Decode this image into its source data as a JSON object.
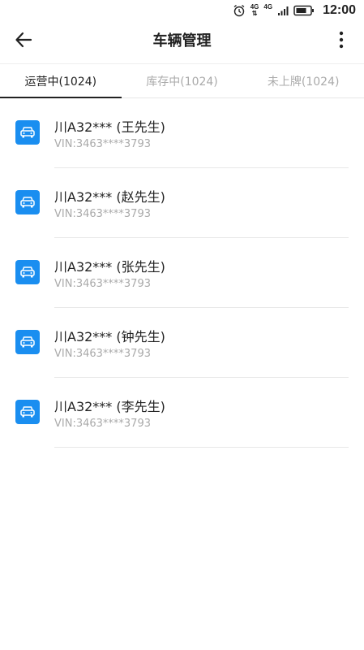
{
  "status_bar": {
    "time": "12:00",
    "net1": "4G",
    "net2": "4G",
    "icons": [
      "alarm-icon",
      "signal-4g-icon",
      "signal-4g-icon",
      "signal-bars-icon",
      "battery-icon"
    ]
  },
  "toolbar": {
    "title": "车辆管理",
    "back_icon": "arrow-left-icon",
    "more_icon": "more-vertical-icon"
  },
  "tabs": [
    {
      "label": "运营中(1024)",
      "active": true
    },
    {
      "label": "库存中(1024)",
      "active": false
    },
    {
      "label": "未上牌(1024)",
      "active": false
    }
  ],
  "vehicles": [
    {
      "plate": "川A32*** (王先生)",
      "vin": "VIN:3463****3793"
    },
    {
      "plate": "川A32*** (赵先生)",
      "vin": "VIN:3463****3793"
    },
    {
      "plate": "川A32*** (张先生)",
      "vin": "VIN:3463****3793"
    },
    {
      "plate": "川A32*** (钟先生)",
      "vin": "VIN:3463****3793"
    },
    {
      "plate": "川A32*** (李先生)",
      "vin": "VIN:3463****3793"
    }
  ],
  "colors": {
    "accent": "#1a8ef0",
    "text_primary": "#222222",
    "text_secondary": "#aaaaaa",
    "divider": "#e8e8e8"
  }
}
